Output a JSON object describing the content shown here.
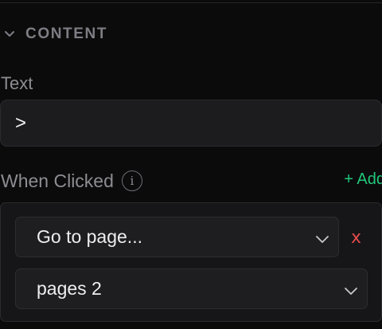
{
  "section": {
    "title": "CONTENT"
  },
  "text_field": {
    "label": "Text",
    "value": ">"
  },
  "when_clicked": {
    "label": "When Clicked",
    "info": "i",
    "add_label": "+ Add"
  },
  "actions": {
    "action_select": "Go to page...",
    "remove_label": "x",
    "page_select": "pages 2"
  },
  "colors": {
    "accent_green": "#21c77a",
    "remove_red": "#e04a4a",
    "background": "#0b0b0c"
  }
}
